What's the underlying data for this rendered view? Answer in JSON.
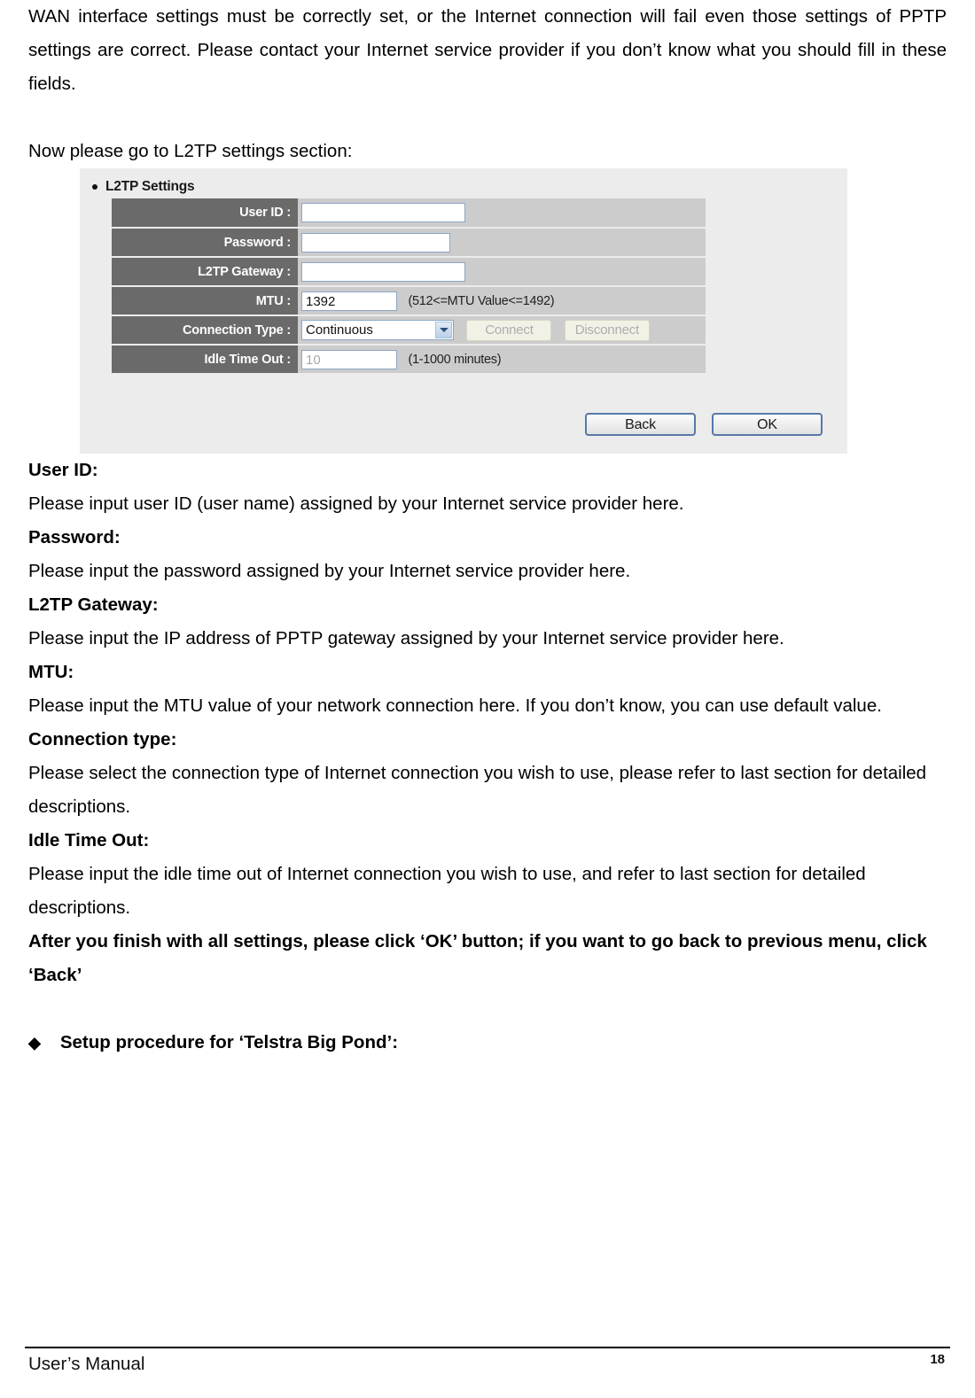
{
  "document": {
    "intro_paragraph": "WAN interface settings must be correctly set, or the Internet connection will fail even those settings of PPTP settings are correct. Please contact your Internet service provider if you don’t know what you should fill in these fields.",
    "lead_in": "Now please go to L2TP settings section:",
    "sections": [
      {
        "heading": "User ID:",
        "body": "Please input user ID (user name) assigned by your Internet service provider here."
      },
      {
        "heading": "Password:",
        "body": "Please input the password assigned by your Internet service provider here."
      },
      {
        "heading": "L2TP Gateway:",
        "body": "Please input the IP address of PPTP gateway assigned by your Internet service provider here."
      },
      {
        "heading": "MTU:",
        "body": "Please input the MTU value of your network connection here. If you don’t know, you can use default value."
      },
      {
        "heading": "Connection type:",
        "body": "Please select the connection type of Internet connection you wish to use, please refer to last section for detailed descriptions."
      },
      {
        "heading": "Idle Time Out:",
        "body": " Please input the idle time out of Internet connection you wish to use, and refer to last section for detailed descriptions."
      }
    ],
    "closing_note": "After you finish with all settings, please click ‘OK’ button; if you want to go back to previous menu, click ‘Back’",
    "next_topic": {
      "bullet_glyph": "◆",
      "label": "Setup procedure for ‘Telstra Big Pond’:"
    }
  },
  "screenshot": {
    "panel_title": "L2TP Settings",
    "bullet_icon": "bullet-dot-icon",
    "fields": [
      {
        "label": "User ID :",
        "value": "",
        "placeholder": "",
        "hint": ""
      },
      {
        "label": "Password :",
        "value": "",
        "placeholder": "",
        "hint": ""
      },
      {
        "label": "L2TP Gateway :",
        "value": "",
        "placeholder": "",
        "hint": ""
      },
      {
        "label": "MTU :",
        "value": "1392",
        "placeholder": "",
        "hint": "(512<=MTU Value<=1492)"
      },
      {
        "label": "Connection Type :",
        "value": "Continuous",
        "placeholder": "",
        "hint": ""
      },
      {
        "label": "Idle Time Out :",
        "value": "10",
        "placeholder": "",
        "hint": "(1-1000 minutes)"
      }
    ],
    "connection_type_selected": "Continuous",
    "connect_button": "Connect",
    "disconnect_button": "Disconnect",
    "back_button": "Back",
    "ok_button": "OK",
    "dropdown_icon": "chevron-down-icon",
    "colors": {
      "panel_background": "#ECECEC",
      "label_cell": "#6A6A6A",
      "field_cell": "#CCCCCC",
      "input_border": "#8BA7C4",
      "main_button_border": "#5679A6",
      "disabled_button_bg": "#F2F1E6"
    }
  },
  "footer": {
    "left_text": "User’s Manual",
    "page_number": "18"
  }
}
